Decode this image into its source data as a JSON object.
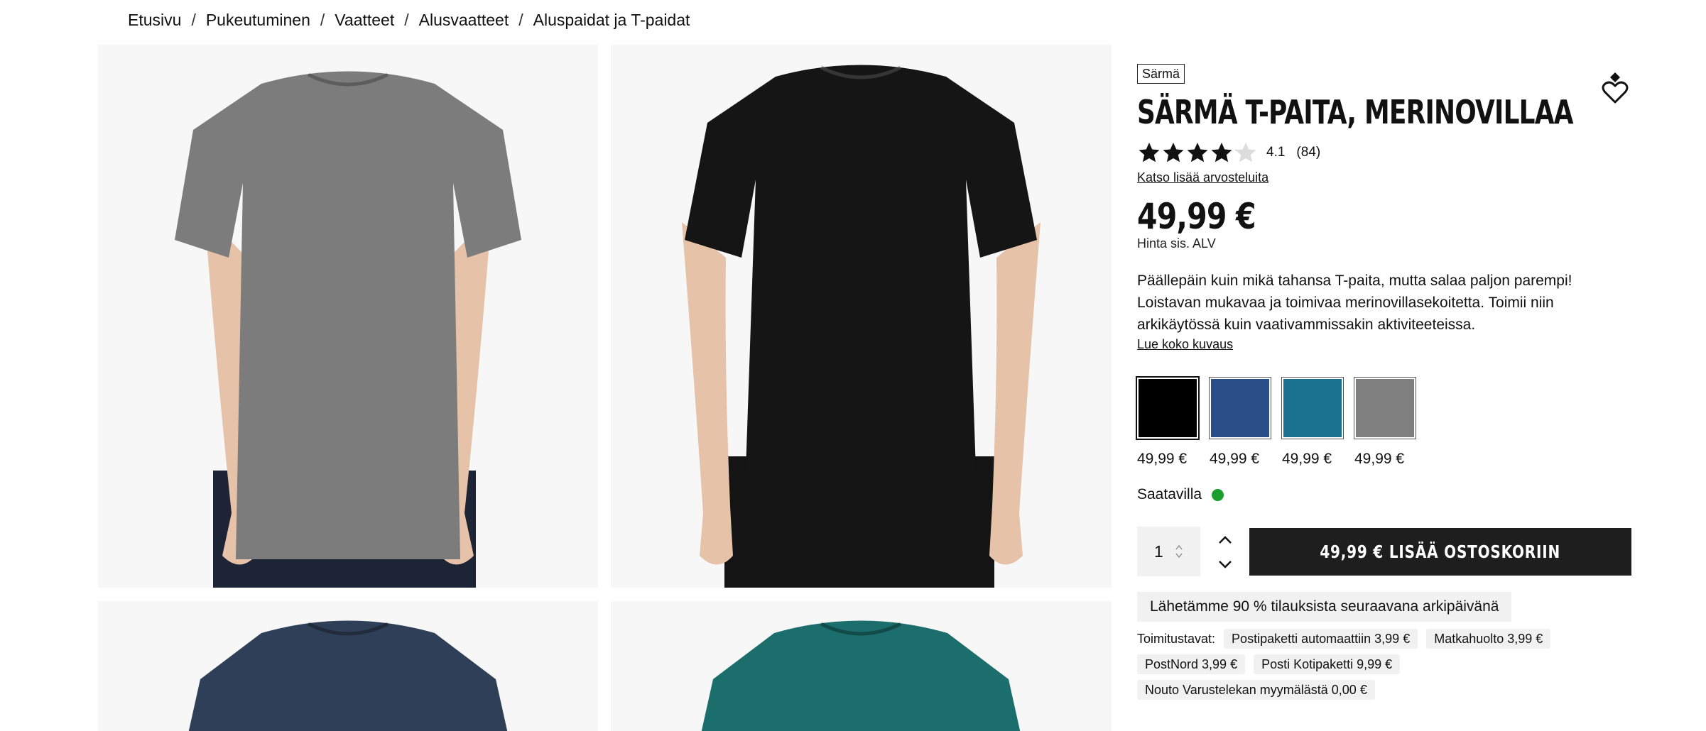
{
  "breadcrumb": {
    "items": [
      "Etusivu",
      "Pukeutuminen",
      "Vaatteet",
      "Alusvaatteet",
      "Aluspaidat ja T-paidat"
    ],
    "separator": "/"
  },
  "gallery": {
    "images": [
      {
        "name": "grey-tshirt-front",
        "shirt_color": "#7c7c7c"
      },
      {
        "name": "black-tshirt-front",
        "shirt_color": "#151515"
      },
      {
        "name": "navy-tshirt-front",
        "shirt_color": "#2f3f57"
      },
      {
        "name": "teal-tshirt-front",
        "shirt_color": "#1b6e6b"
      }
    ]
  },
  "product": {
    "brand": "Särmä",
    "title": "SÄRMÄ T-PAITA, MERINOVILLAA",
    "rating": {
      "value": "4.1",
      "count": "(84)",
      "stars_filled": 4.1,
      "stars_total": 5
    },
    "reviews_link": "Katso lisää arvosteluita",
    "price": "49,99 €",
    "vat_note": "Hinta sis. ALV",
    "description": "Päällepäin kuin mikä tahansa T-paita, mutta salaa paljon parempi! Loistavan mukavaa ja toimivaa merinovillasekoitetta. Toimii niin arkikäytössä kuin vaativammissakin aktiviteeteissa.",
    "description_link": "Lue koko kuvaus",
    "wishlist_icon": "heart-icon"
  },
  "variants": [
    {
      "color": "#000000",
      "price": "49,99 €",
      "selected": true
    },
    {
      "color": "#2a4f88",
      "price": "49,99 €",
      "selected": false
    },
    {
      "color": "#1b7290",
      "price": "49,99 €",
      "selected": false
    },
    {
      "color": "#808080",
      "price": "49,99 €",
      "selected": false
    }
  ],
  "availability": {
    "label": "Saatavilla",
    "status_color": "#1a9f2f"
  },
  "cart": {
    "quantity": "1",
    "add_button": "49,99 € LISÄÄ OSTOSKORIIN"
  },
  "shipping": {
    "note": "Lähetämme 90 % tilauksista seuraavana arkipäivänä",
    "label": "Toimitustavat:",
    "options": [
      "Postipaketti automaattiin 3,99 €",
      "Matkahuolto 3,99 €",
      "PostNord 3,99 €",
      "Posti Kotipaketti 9,99 €",
      "Nouto Varustelekan myymälästä 0,00 €"
    ]
  },
  "colors": {
    "button_bg": "#1e1e1e",
    "chip_bg": "#f1f1f1",
    "available": "#1a9f2f"
  }
}
